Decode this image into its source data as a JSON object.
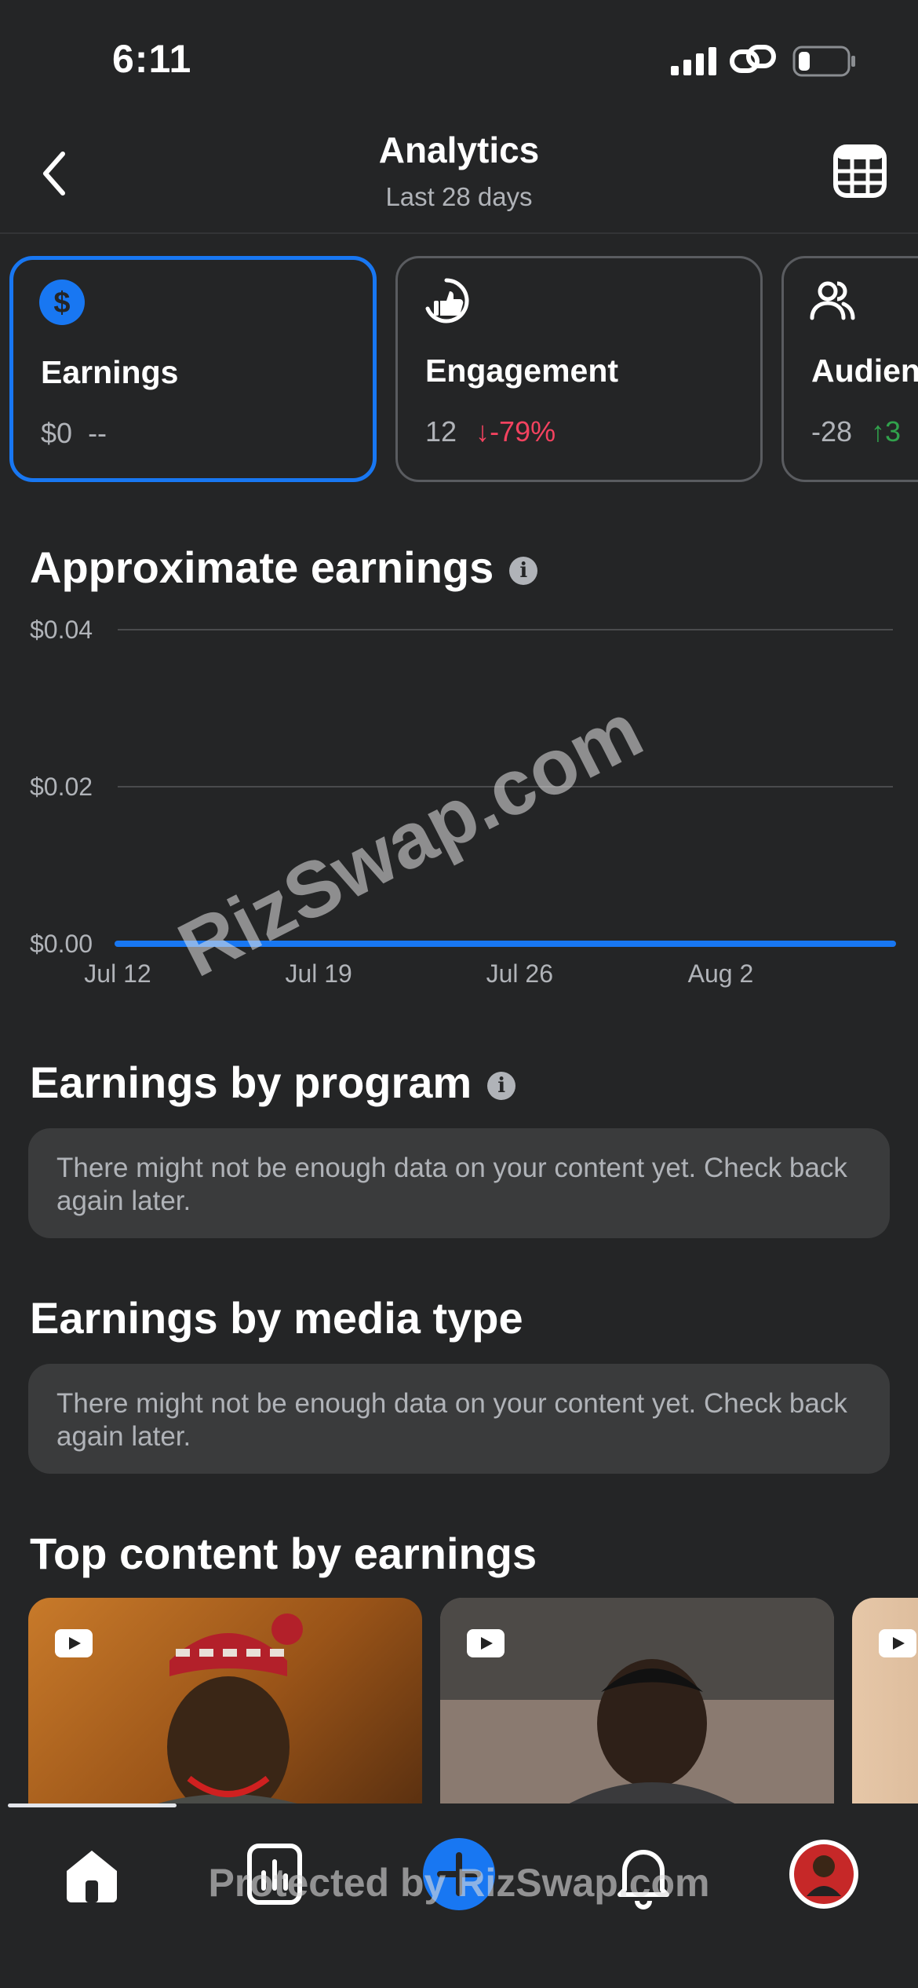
{
  "status_bar": {
    "time": "6:11"
  },
  "header": {
    "title": "Analytics",
    "subtitle": "Last 28 days"
  },
  "cards": [
    {
      "label": "Earnings",
      "value": "$0",
      "change": "--",
      "icon": "dollar-icon",
      "active": true
    },
    {
      "label": "Engagement",
      "value": "12",
      "change": "-79%",
      "direction": "down",
      "icon": "thumbs-up-icon"
    },
    {
      "label": "Audien",
      "value": "-28",
      "change": "3",
      "direction": "up",
      "icon": "people-icon"
    }
  ],
  "earnings_section": {
    "title": "Approximate earnings"
  },
  "chart_data": {
    "type": "line",
    "title": "Approximate earnings",
    "y_ticks": [
      "$0.04",
      "$0.02",
      "$0.00"
    ],
    "ylim": [
      0,
      0.04
    ],
    "x_ticks": [
      "Jul 12",
      "Jul 19",
      "Jul 26",
      "Aug 2"
    ],
    "series": [
      {
        "values": [
          0,
          0,
          0,
          0,
          0,
          0,
          0,
          0,
          0,
          0,
          0,
          0,
          0,
          0,
          0,
          0,
          0,
          0,
          0,
          0,
          0,
          0,
          0,
          0,
          0,
          0,
          0,
          0
        ]
      }
    ],
    "grid": true,
    "color": "#1877f2"
  },
  "program_section": {
    "title": "Earnings by program",
    "notice": "There might not be enough data on your content yet. Check back again later."
  },
  "media_section": {
    "title": "Earnings by media type",
    "notice": "There might not be enough data on your content yet. Check back again later."
  },
  "top_content": {
    "title": "Top content by earnings"
  },
  "nav": {
    "items": [
      "home-icon",
      "insights-icon",
      "create-icon",
      "notifications-icon",
      "profile-avatar"
    ]
  },
  "watermarks": {
    "diagonal": "RizSwap.com",
    "bottom": "Protected by RizSwap.com"
  },
  "colors": {
    "accent": "#1877f2",
    "negative": "#f3425f",
    "positive": "#31a24c",
    "background": "#242526"
  }
}
